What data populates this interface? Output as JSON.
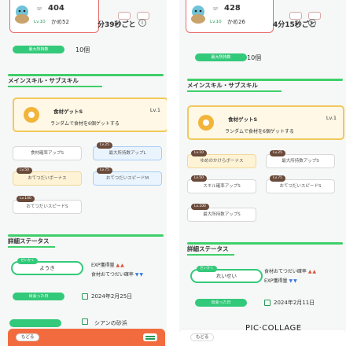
{
  "watermark": "PIC·COLLAGE",
  "left": {
    "sp_label": "SP",
    "sp_value": "404",
    "level": "Lv.10",
    "name": "かめ52",
    "timer": "分39秒ごと",
    "info_icon": "info-icon",
    "max_label": "最大所持数",
    "max_count": "10個",
    "section1_title": "メインスキル・サブスキル",
    "main_skill_name": "食材ゲットS",
    "main_skill_level": "Lv.1",
    "main_skill_desc": "ランダムで食材を6個ゲットする",
    "subskills": [
      {
        "label": "食材確率アップS",
        "tag": "Lv.10",
        "style": "plain"
      },
      {
        "label": "最大所持数アップL",
        "tag": "Lv.25",
        "style": "blue"
      },
      {
        "label": "おてつだいボーナス",
        "tag": "Lv.50",
        "style": "yellow"
      },
      {
        "label": "おてつだいスピードM",
        "tag": "Lv.75",
        "style": "blue"
      },
      {
        "label": "おてつだいスピードS",
        "tag": "Lv.100",
        "style": "plain"
      }
    ],
    "section2_title": "詳細ステータス",
    "nature_tag": "せいかく",
    "nature": "ようき",
    "stat_up_label": "EXP獲得量",
    "stat_up_marks": "▲▲",
    "stat_down_label": "食材おてつだい確率",
    "stat_down_marks": "▼▼",
    "met_label": "出会った日",
    "met_date": "2024年2月25日",
    "bottom_text": "シアンの砂浜",
    "back_button": "もどる"
  },
  "right": {
    "sp_label": "SP",
    "sp_value": "428",
    "level": "Lv.10",
    "name": "かめ26",
    "timer": "4分15秒ごと",
    "info_icon": "info-icon",
    "max_label": "最大所持数",
    "max_count": "10個",
    "section1_title": "メインスキル・サブスキル",
    "main_skill_name": "食材ゲットS",
    "main_skill_level": "Lv.1",
    "main_skill_desc": "ランダムで食材を6個ゲットする",
    "subskills": [
      {
        "label": "ゆめのかけらボーナス",
        "tag": "Lv.10",
        "style": "yellow"
      },
      {
        "label": "最大所持数アップS",
        "tag": "Lv.25",
        "style": "plain"
      },
      {
        "label": "スキル確率アップS",
        "tag": "Lv.50",
        "style": "plain"
      },
      {
        "label": "おてつだいスピードS",
        "tag": "Lv.75",
        "style": "plain"
      },
      {
        "label": "最大所持数アップS",
        "tag": "Lv.100",
        "style": "plain"
      }
    ],
    "section2_title": "詳細ステータス",
    "nature_tag": "せいかく",
    "nature": "れいせい",
    "stat_up_label": "食材おてつだい確率",
    "stat_up_marks": "▲▲",
    "stat_down_label": "EXP獲得量",
    "stat_down_marks": "▼▼",
    "met_label": "出会った日",
    "met_date": "2024年2月11日",
    "back_button": "もどる"
  }
}
